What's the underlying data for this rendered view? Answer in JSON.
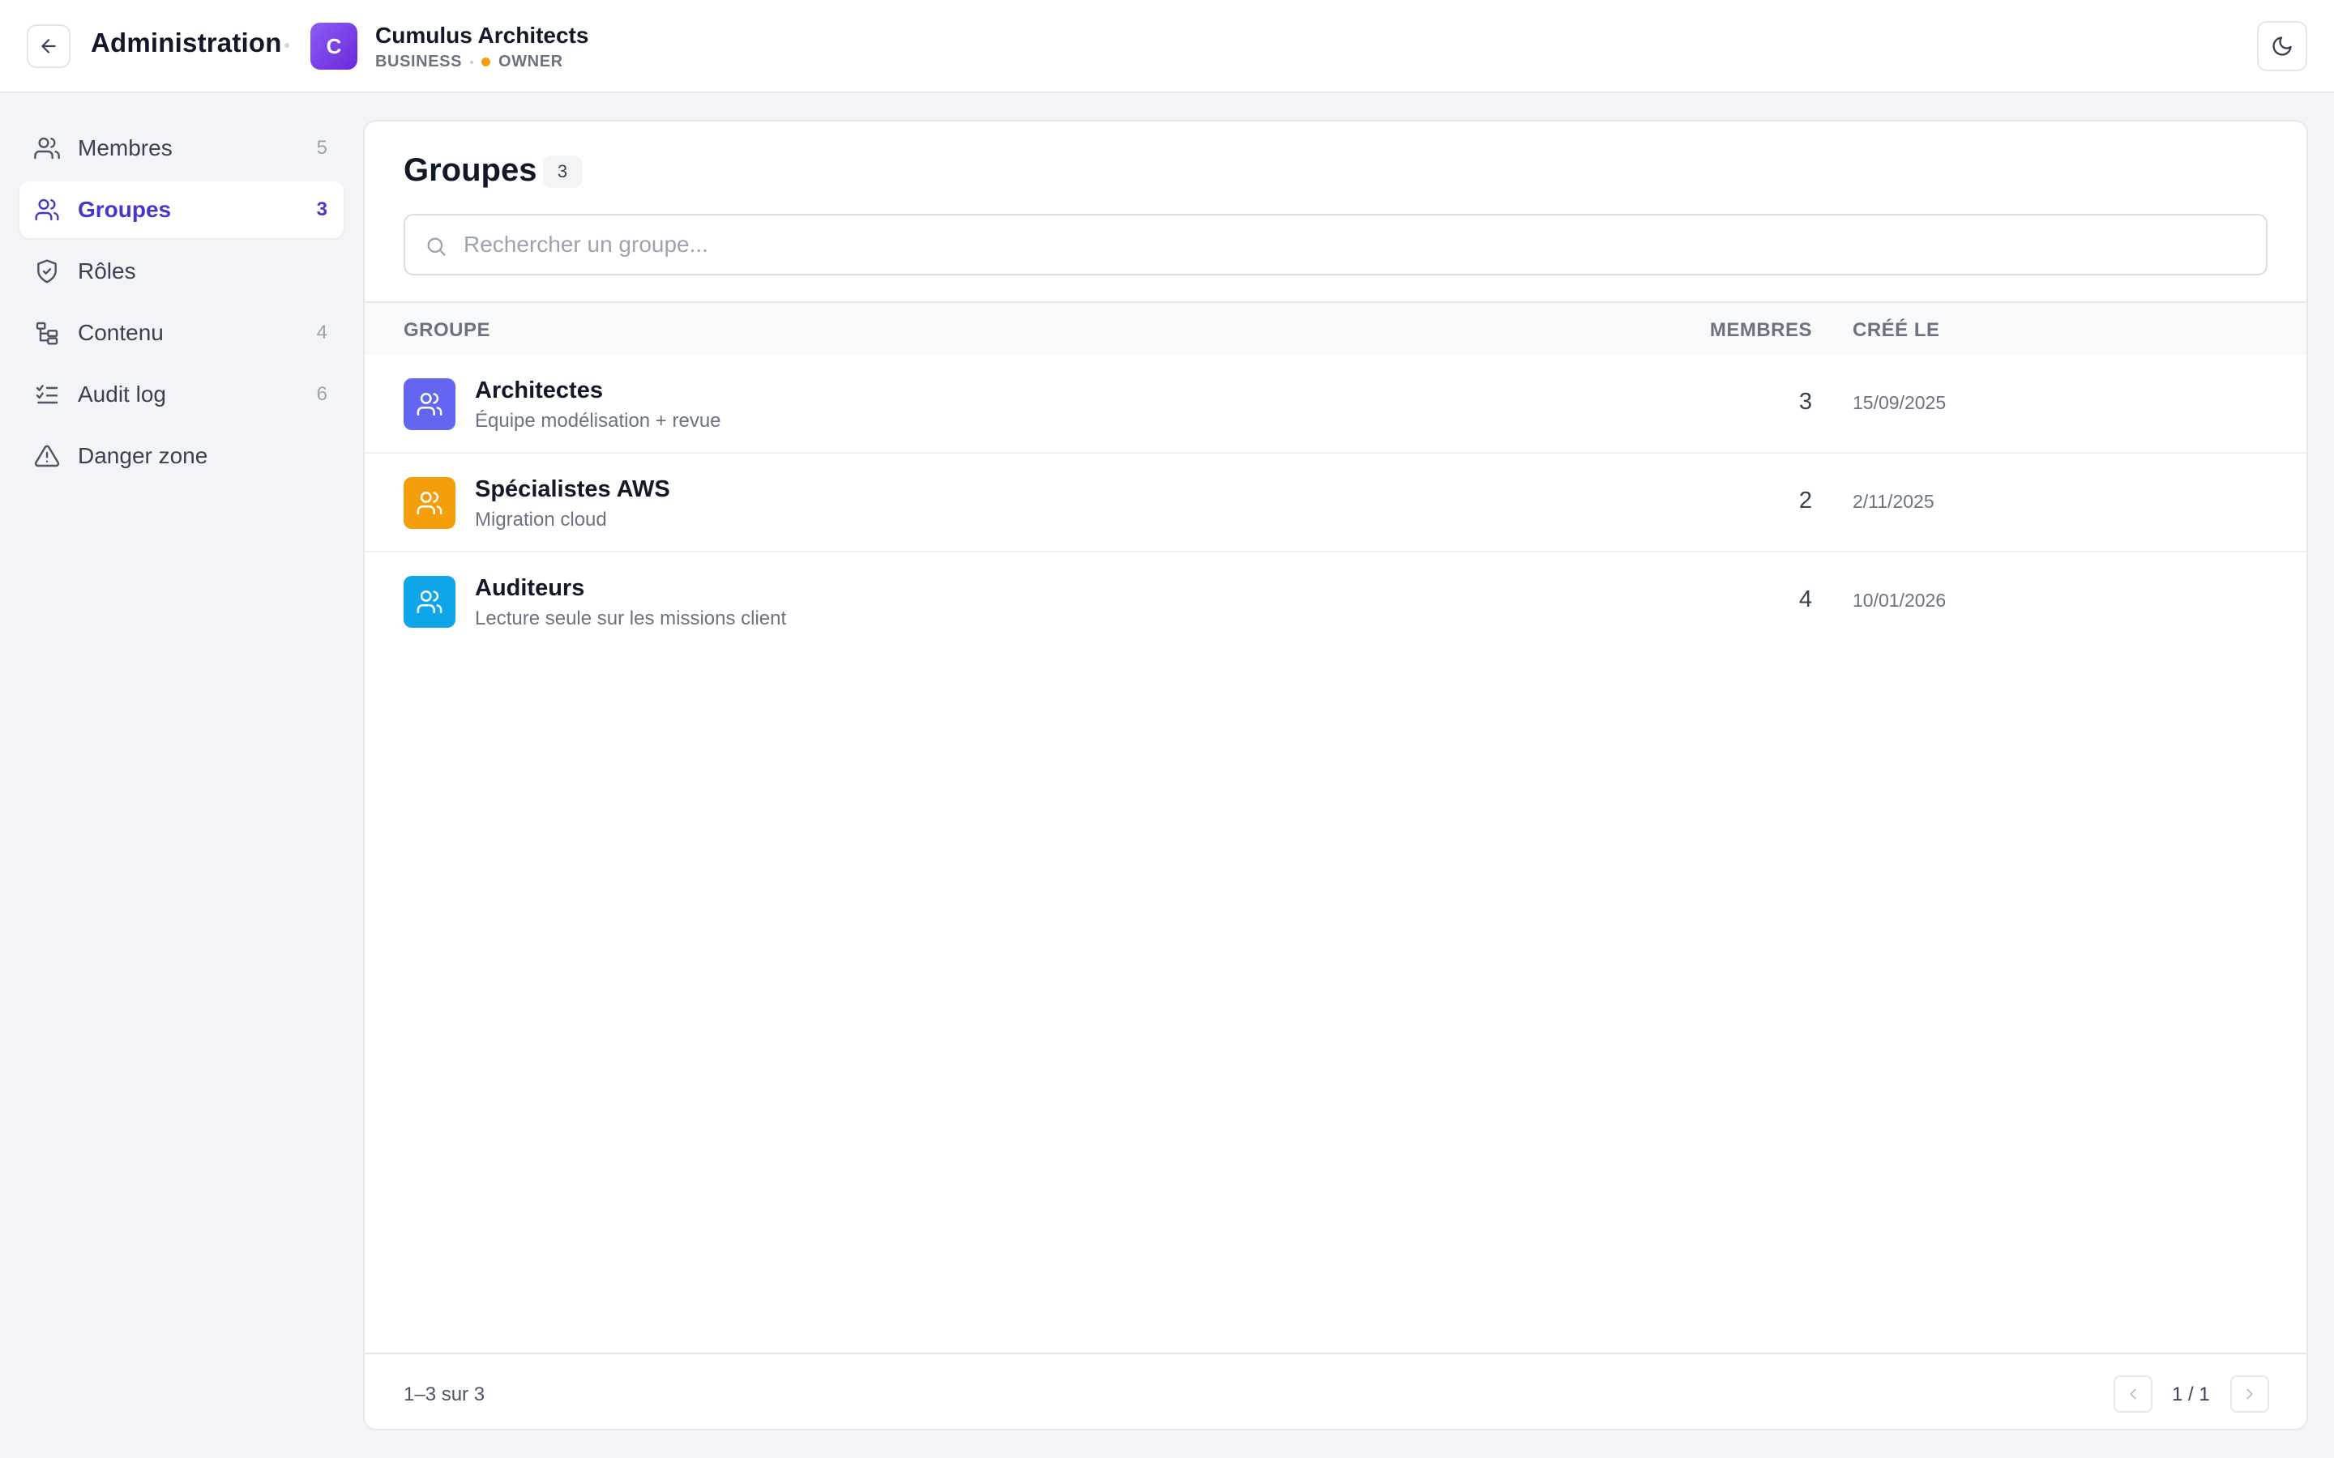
{
  "header": {
    "title": "Administration",
    "org": {
      "initial": "C",
      "name": "Cumulus Architects",
      "plan": "BUSINESS",
      "role": "OWNER",
      "role_color": "#f59e0b",
      "avatar_color": "#7c3aed"
    },
    "back_icon": "arrow-left-icon",
    "theme_icon": "moon-icon"
  },
  "sidebar": {
    "items": [
      {
        "label": "Membres",
        "count": "5",
        "icon": "users-icon",
        "active": false
      },
      {
        "label": "Groupes",
        "count": "3",
        "icon": "user-group-icon",
        "active": true
      },
      {
        "label": "Rôles",
        "count": "",
        "icon": "shield-check-icon",
        "active": false
      },
      {
        "label": "Contenu",
        "count": "4",
        "icon": "folder-tree-icon",
        "active": false
      },
      {
        "label": "Audit log",
        "count": "6",
        "icon": "list-checks-icon",
        "active": false
      },
      {
        "label": "Danger zone",
        "count": "",
        "icon": "warning-triangle-icon",
        "active": false
      }
    ],
    "active_color": "#4338ca"
  },
  "main": {
    "title": "Groupes",
    "count": "3",
    "search": {
      "placeholder": "Rechercher un groupe...",
      "value": ""
    },
    "table": {
      "columns": [
        "GROUPE",
        "MEMBRES",
        "CRÉÉ LE"
      ],
      "rows": [
        {
          "name": "Architectes",
          "description": "Équipe modélisation + revue",
          "members": "3",
          "created": "15/09/2025",
          "color": "#6366f1"
        },
        {
          "name": "Spécialistes AWS",
          "description": "Migration cloud",
          "members": "2",
          "created": "2/11/2025",
          "color": "#f59e0b"
        },
        {
          "name": "Auditeurs",
          "description": "Lecture seule sur les missions client",
          "members": "4",
          "created": "10/01/2026",
          "color": "#0ea5e9"
        }
      ]
    },
    "footer": {
      "range": "1–3 sur 3",
      "page": "1 / 1"
    }
  }
}
